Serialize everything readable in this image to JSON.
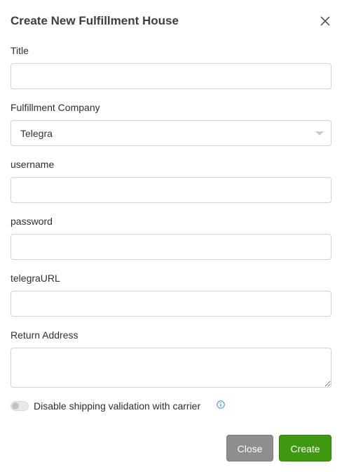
{
  "modal": {
    "title": "Create New Fulfillment House"
  },
  "fields": {
    "title": {
      "label": "Title",
      "value": ""
    },
    "company": {
      "label": "Fulfillment Company",
      "value": "Telegra"
    },
    "username": {
      "label": "username",
      "value": ""
    },
    "password": {
      "label": "password",
      "value": ""
    },
    "telegra_url": {
      "label": "telegraURL",
      "value": ""
    },
    "return_address": {
      "label": "Return Address",
      "value": ""
    }
  },
  "toggle": {
    "label": "Disable shipping validation with carrier",
    "checked": false
  },
  "icons": {
    "close": "close-icon",
    "caret": "chevron-down-icon",
    "info": "info-icon"
  },
  "buttons": {
    "close_label": "Close",
    "create_label": "Create"
  },
  "colors": {
    "create": "#3e9910",
    "close": "#8e8e8e",
    "info": "#2f8fd8"
  }
}
